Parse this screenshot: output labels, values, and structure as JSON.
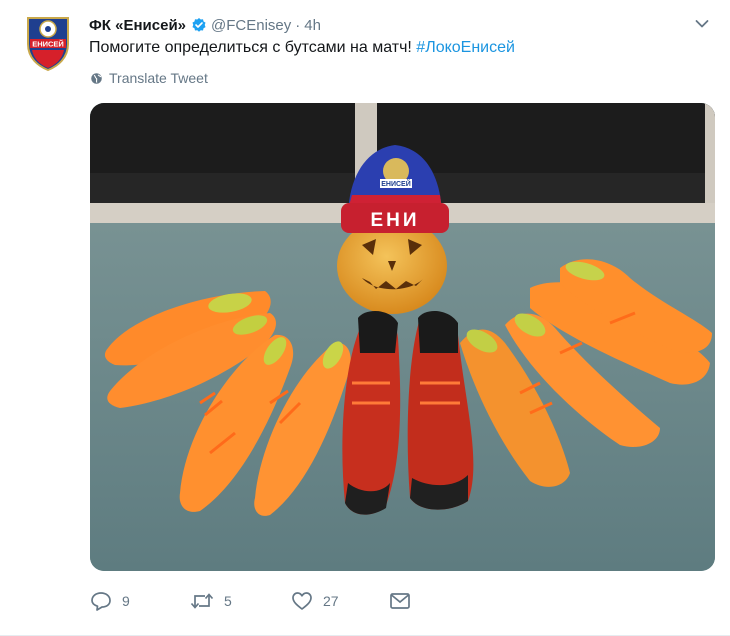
{
  "tweet": {
    "display_name": "ФК «Енисей»",
    "handle": "@FCEnisey",
    "separator": "·",
    "time": "4h",
    "text": "Помогите определиться с бутсами на матч! ",
    "hashtag": "#ЛокоЕнисей",
    "translate_label": "Translate Tweet",
    "avatar_text": "ЕНИСЕЙ",
    "hat_text": "ЕНИСЕЙ",
    "hat_text_2": "ЕНИ",
    "icons": {
      "verified": "verified-badge-icon",
      "caret": "chevron-down-icon",
      "translate": "globe-icon",
      "reply": "reply-icon",
      "retweet": "retweet-icon",
      "like": "heart-icon",
      "message": "envelope-icon"
    },
    "actions": {
      "replies": "9",
      "retweets": "5",
      "likes": "27"
    },
    "colors": {
      "link": "#1b95e0",
      "secondary": "#657786",
      "verified": "#1da1f2"
    }
  }
}
